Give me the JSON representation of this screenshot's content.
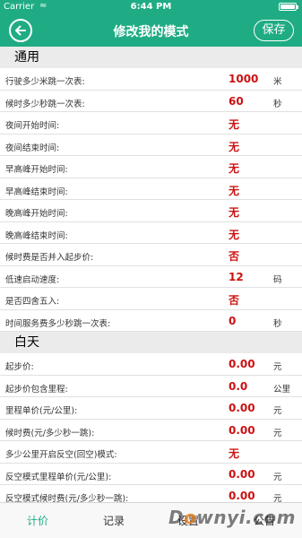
{
  "status_bar": {
    "carrier": "Carrier",
    "wifi_icon": "wifi-icon",
    "time": "6:44 PM",
    "battery_icon": "battery-icon"
  },
  "nav": {
    "back_icon": "back-arrow-icon",
    "title": "修改我的模式",
    "save_label": "保存"
  },
  "sections": [
    {
      "title": "通用",
      "rows": [
        {
          "label": "行驶多少米跳一次表:",
          "value": "1000",
          "unit": "米"
        },
        {
          "label": "候时多少秒跳一次表:",
          "value": "60",
          "unit": "秒"
        },
        {
          "label": "夜间开始时间:",
          "value": "无",
          "unit": ""
        },
        {
          "label": "夜间结束时间:",
          "value": "无",
          "unit": ""
        },
        {
          "label": "早高峰开始时间:",
          "value": "无",
          "unit": ""
        },
        {
          "label": "早高峰结束时间:",
          "value": "无",
          "unit": ""
        },
        {
          "label": "晚高峰开始时间:",
          "value": "无",
          "unit": ""
        },
        {
          "label": "晚高峰结束时间:",
          "value": "无",
          "unit": ""
        },
        {
          "label": "候时费是否并入起步价:",
          "value": "否",
          "unit": ""
        },
        {
          "label": "低速启动速度:",
          "value": "12",
          "unit": "码"
        },
        {
          "label": "是否四舍五入:",
          "value": "否",
          "unit": ""
        },
        {
          "label": "时间服务费多少秒跳一次表:",
          "value": "0",
          "unit": "秒"
        }
      ]
    },
    {
      "title": "白天",
      "rows": [
        {
          "label": "起步价:",
          "value": "0.00",
          "unit": "元"
        },
        {
          "label": "起步价包含里程:",
          "value": "0.0",
          "unit": "公里"
        },
        {
          "label": "里程单价(元/公里):",
          "value": "0.00",
          "unit": "元"
        },
        {
          "label": "候时费(元/多少秒一跳):",
          "value": "0.00",
          "unit": "元"
        },
        {
          "label": "多少公里开启反空(回空)模式:",
          "value": "无",
          "unit": ""
        },
        {
          "label": "反空模式里程单价(元/公里):",
          "value": "0.00",
          "unit": "元"
        },
        {
          "label": "反空模式候时费(元/多少秒一跳):",
          "value": "0.00",
          "unit": "元"
        }
      ]
    }
  ],
  "tabs": [
    {
      "label": "计价",
      "active": true
    },
    {
      "label": "记录",
      "active": false
    },
    {
      "label": "设置",
      "active": false
    },
    {
      "label": "公告",
      "active": false
    }
  ],
  "watermark": {
    "prefix": "D",
    "o": "o",
    "suffix": "wnyi.com"
  },
  "colors": {
    "brand": "#1fac84",
    "value_red": "#cc1111",
    "section_bg": "#ebebeb"
  }
}
